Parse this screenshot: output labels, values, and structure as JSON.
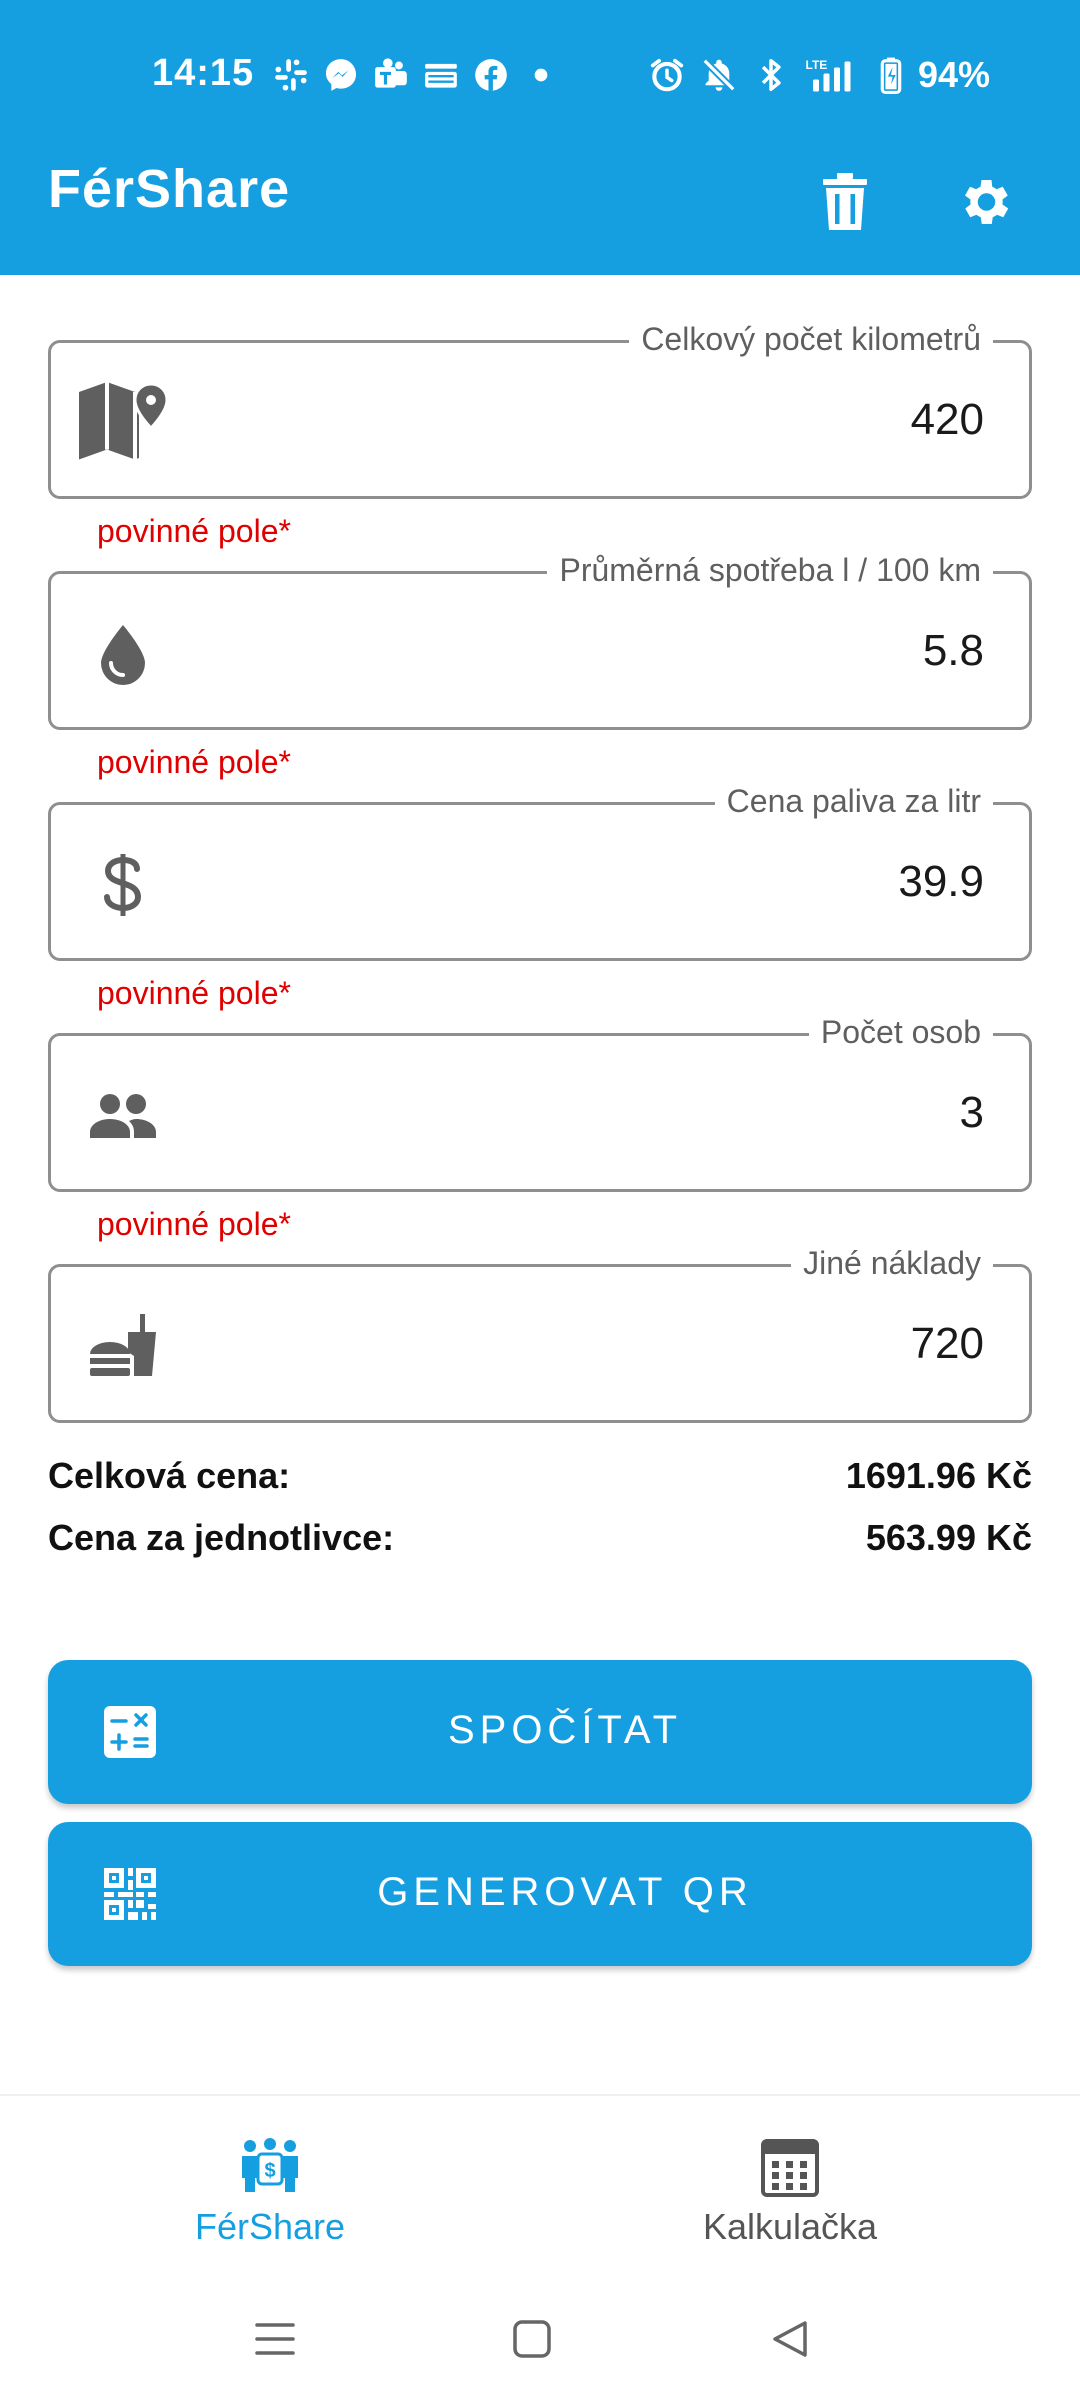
{
  "status_bar": {
    "time": "14:15",
    "app_icons": [
      "slack-icon",
      "messenger-icon",
      "teams-icon",
      "temu-icon",
      "facebook-icon",
      "dot-icon"
    ],
    "system_icons": [
      "alarm-icon",
      "bell-off-icon",
      "bluetooth-icon",
      "lte-signal-icon",
      "battery-icon"
    ],
    "battery": "94%"
  },
  "app_bar": {
    "title": "FérShare",
    "delete_icon": "trash-icon",
    "settings_icon": "gear-icon"
  },
  "fields": [
    {
      "label": "Celkový počet kilometrů",
      "value": "420",
      "icon": "map-pin-icon"
    },
    {
      "label": "Průměrná spotřeba l / 100 km",
      "value": "5.8",
      "icon": "drop-icon"
    },
    {
      "label": "Cena paliva za litr",
      "value": "39.9",
      "icon": "dollar-icon"
    },
    {
      "label": "Počet osob",
      "value": "3",
      "icon": "people-icon"
    },
    {
      "label": "Jiné náklady",
      "value": "720",
      "icon": "fastfood-icon"
    }
  ],
  "required_text": "povinné pole*",
  "totals": {
    "total_label": "Celková cena:",
    "total_value": "1691.96 Kč",
    "per_person_label": "Cena za jednotlivce:",
    "per_person_value": "563.99 Kč"
  },
  "actions": {
    "calculate_label": "SPOČÍTAT",
    "calculate_icon": "calculator-icon",
    "qr_label": "GENEROVAT QR",
    "qr_icon": "qr-code-icon"
  },
  "bottom_nav": [
    {
      "label": "FérShare",
      "icon": "people-money-icon",
      "active": true
    },
    {
      "label": "Kalkulačka",
      "icon": "calculator-grid-icon",
      "active": false
    }
  ],
  "colors": {
    "primary": "#159fe0",
    "required": "#e00000",
    "border": "#8f8f8f",
    "icon_gray": "#5f5f5f"
  }
}
